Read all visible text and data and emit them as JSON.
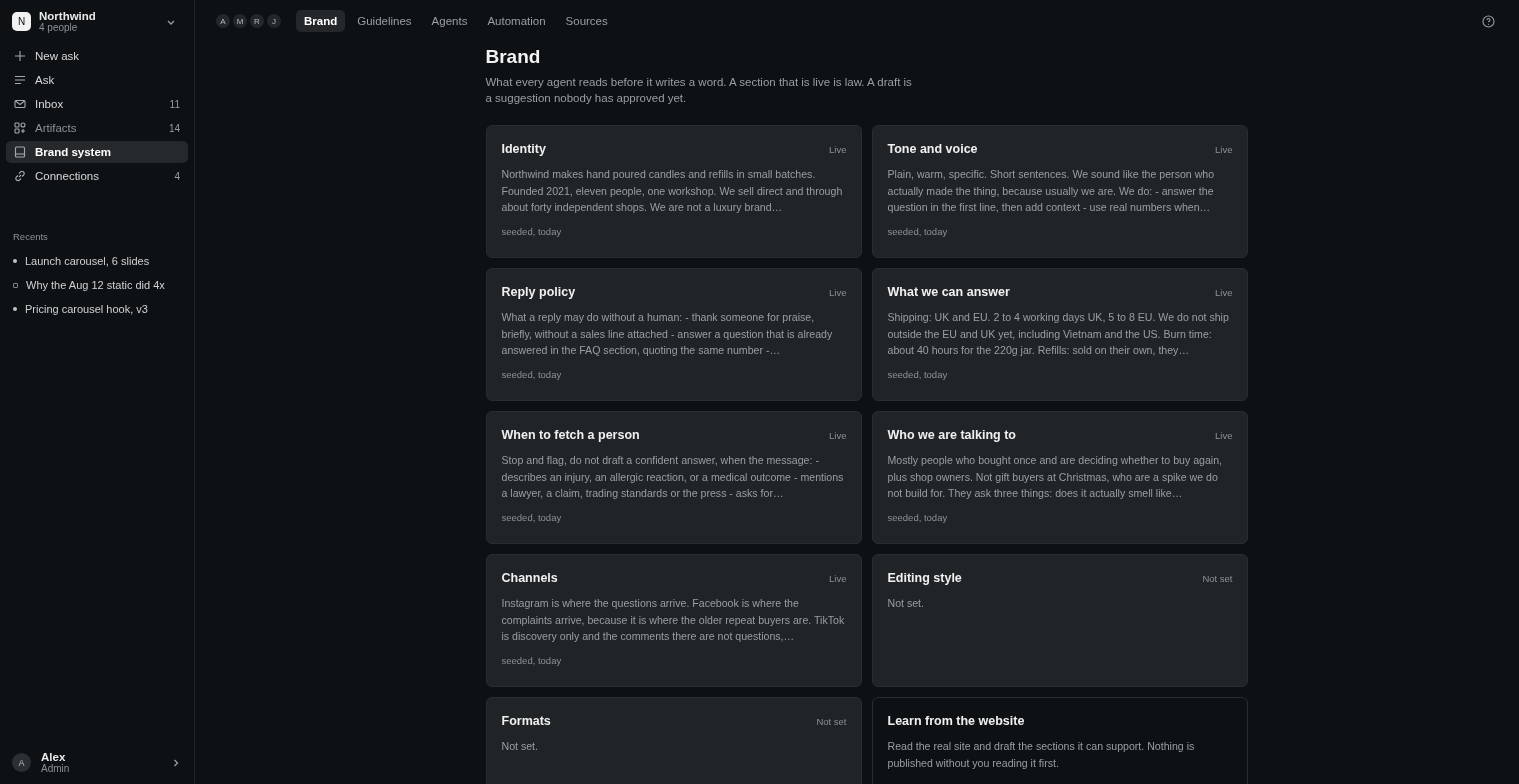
{
  "workspace": {
    "initial": "N",
    "name": "Northwind",
    "members": "4 people"
  },
  "nav": [
    {
      "label": "New ask",
      "selected": false,
      "disabled": false
    },
    {
      "label": "Ask",
      "selected": false,
      "disabled": false
    },
    {
      "label": "Inbox",
      "count": "11",
      "selected": false,
      "disabled": false
    },
    {
      "label": "Artifacts",
      "count": "14",
      "selected": false,
      "disabled": true
    },
    {
      "label": "Brand system",
      "selected": true,
      "disabled": false
    },
    {
      "label": "Connections",
      "count": "4",
      "selected": false,
      "disabled": false
    }
  ],
  "recents": {
    "heading": "Recents",
    "items": [
      {
        "label": "Launch carousel, 6 slides",
        "kind": "filled"
      },
      {
        "label": "Why the Aug 12 static did 4x",
        "kind": "hollow"
      },
      {
        "label": "Pricing carousel hook, v3",
        "kind": "filled"
      }
    ]
  },
  "user": {
    "initial": "A",
    "name": "Alex",
    "role": "Admin"
  },
  "members": [
    "A",
    "M",
    "R",
    "J"
  ],
  "tabs": [
    {
      "label": "Brand",
      "selected": true
    },
    {
      "label": "Guidelines",
      "selected": false
    },
    {
      "label": "Agents",
      "selected": false
    },
    {
      "label": "Automation",
      "selected": false
    },
    {
      "label": "Sources",
      "selected": false
    }
  ],
  "page": {
    "title": "Brand",
    "intro": "What every agent reads before it writes a word. A section that is live is law. A draft is a suggestion nobody has approved yet."
  },
  "cards": [
    {
      "kind": "section",
      "title": "Identity",
      "status": "Live",
      "body": "Northwind makes hand poured candles and refills in small batches. Founded 2021, eleven people, one workshop. We sell direct and through about forty independent shops. We are not a luxury brand…",
      "meta": "seeded, today"
    },
    {
      "kind": "section",
      "title": "Tone and voice",
      "status": "Live",
      "body": "Plain, warm, specific. Short sentences. We sound like the person who actually made the thing, because usually we are. We do: - answer the question in the first line, then add context - use real numbers when…",
      "meta": "seeded, today"
    },
    {
      "kind": "section",
      "title": "Reply policy",
      "status": "Live",
      "body": "What a reply may do without a human: - thank someone for praise, briefly, without a sales line attached - answer a question that is already answered in the FAQ section, quoting the same number -…",
      "meta": "seeded, today"
    },
    {
      "kind": "section",
      "title": "What we can answer",
      "status": "Live",
      "body": "Shipping: UK and EU. 2 to 4 working days UK, 5 to 8 EU. We do not ship outside the EU and UK yet, including Vietnam and the US. Burn time: about 40 hours for the 220g jar. Refills: sold on their own, they…",
      "meta": "seeded, today"
    },
    {
      "kind": "section",
      "title": "When to fetch a person",
      "status": "Live",
      "body": "Stop and flag, do not draft a confident answer, when the message: - describes an injury, an allergic reaction, or a medical outcome - mentions a lawyer, a claim, trading standards or the press - asks for…",
      "meta": "seeded, today"
    },
    {
      "kind": "section",
      "title": "Who we are talking to",
      "status": "Live",
      "body": "Mostly people who bought once and are deciding whether to buy again, plus shop owners. Not gift buyers at Christmas, who are a spike we do not build for. They ask three things: does it actually smell like…",
      "meta": "seeded, today"
    },
    {
      "kind": "section",
      "title": "Channels",
      "status": "Live",
      "body": "Instagram is where the questions arrive. Facebook is where the complaints arrive, because it is where the older repeat buyers are. TikTok is discovery only and the comments there are not questions,…",
      "meta": "seeded, today"
    },
    {
      "kind": "section",
      "title": "Editing style",
      "status": "Not set",
      "body": "Not set."
    },
    {
      "kind": "section",
      "title": "Formats",
      "status": "Not set",
      "body": "Not set."
    },
    {
      "kind": "action",
      "title": "Learn from the website",
      "body": "Read the real site and draft the sections it can support. Nothing is published without you reading it first."
    }
  ]
}
